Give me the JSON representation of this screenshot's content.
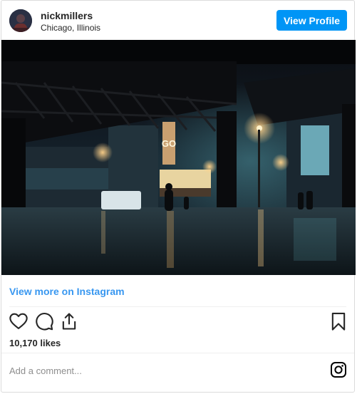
{
  "header": {
    "username": "nickmillers",
    "location": "Chicago, Illinois",
    "view_profile_label": "View Profile"
  },
  "post": {
    "photo_alt": "Night street scene under elevated train tracks with theater marquee",
    "view_more_label": "View more on Instagram",
    "likes_text": "10,170 likes"
  },
  "actions": {
    "icons": [
      "heart-icon",
      "comment-icon",
      "share-icon",
      "bookmark-icon"
    ]
  },
  "comment": {
    "placeholder": "Add a comment..."
  },
  "colors": {
    "accent": "#0095f6",
    "link": "#3897f0",
    "text": "#262626",
    "muted": "#8e8e8e",
    "border": "#dbdbdb"
  }
}
